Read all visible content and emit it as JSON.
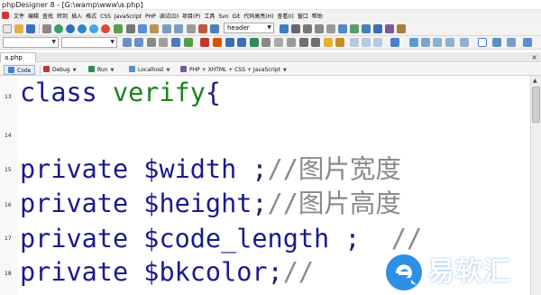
{
  "window": {
    "title": "phpDesigner 8 - [G:\\wamp\\www\\a.php]"
  },
  "menu": [
    "文件",
    "编辑",
    "查找",
    "转到",
    "插入",
    "格式",
    "CSS",
    "JavaScript",
    "PHP",
    "调试(D)",
    "项目(P)",
    "工具",
    "Svn",
    "Git",
    "代码高亮(H)",
    "查看(I)",
    "窗口",
    "帮助"
  ],
  "toolbar": {
    "heading_select": "header"
  },
  "tab": {
    "label": "a.php",
    "close": "×"
  },
  "modebar": {
    "code": "Code",
    "debug": "Debug",
    "run": "Run",
    "localhost": "Localhost",
    "lang": "PHP + XHTML + CSS + JavaScript"
  },
  "code_lines": [
    {
      "num": "13",
      "parts": [
        {
          "t": "class ",
          "c": "kw"
        },
        {
          "t": "verify",
          "c": "cls"
        },
        {
          "t": "{",
          "c": "pun"
        }
      ]
    },
    {
      "num": "14",
      "parts": []
    },
    {
      "num": "15",
      "parts": [
        {
          "t": "private ",
          "c": "kw"
        },
        {
          "t": "$width",
          "c": "var"
        },
        {
          "t": " ;",
          "c": "pun"
        },
        {
          "t": "//图片宽度",
          "c": "cmt"
        }
      ]
    },
    {
      "num": "16",
      "parts": [
        {
          "t": "private ",
          "c": "kw"
        },
        {
          "t": "$height",
          "c": "var"
        },
        {
          "t": ";",
          "c": "pun"
        },
        {
          "t": "//图片高度",
          "c": "cmt"
        }
      ]
    },
    {
      "num": "17",
      "parts": [
        {
          "t": "private ",
          "c": "kw"
        },
        {
          "t": "$code_length",
          "c": "var"
        },
        {
          "t": " ;  ",
          "c": "pun"
        },
        {
          "t": "//",
          "c": "cmt"
        }
      ]
    },
    {
      "num": "18",
      "parts": [
        {
          "t": "private ",
          "c": "kw"
        },
        {
          "t": "$bkcolor",
          "c": "var"
        },
        {
          "t": ";",
          "c": "pun"
        },
        {
          "t": "//",
          "c": "cmt"
        }
      ]
    }
  ],
  "watermark": {
    "text": "易软汇"
  },
  "colors": {
    "keyword": "#1a1a8c",
    "classname": "#17861a",
    "comment": "#8a8a8a",
    "watermark": "#2e8fe6"
  }
}
